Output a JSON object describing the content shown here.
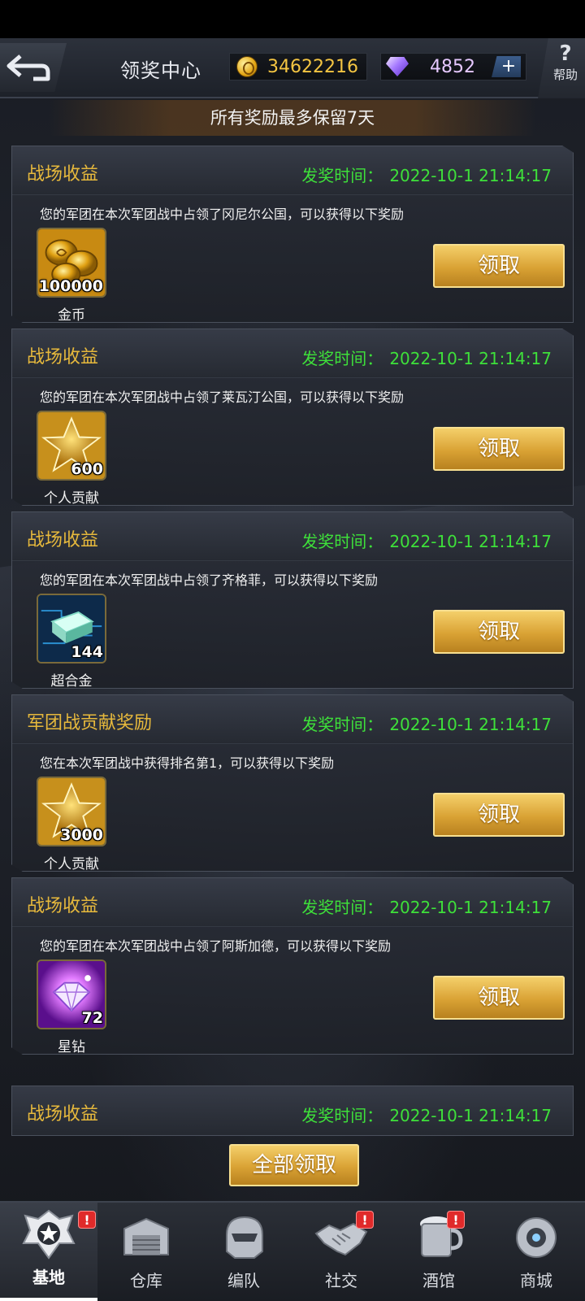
{
  "header": {
    "title": "领奖中心",
    "coins": "34622216",
    "gems": "4852",
    "plus_label": "+",
    "help_icon_glyph": "?",
    "help_label": "帮助"
  },
  "notice": "所有奖励最多保留7天",
  "time_label": "发奖时间：",
  "claim_label": "领取",
  "rewards": [
    {
      "title": "战场收益",
      "time": "2022-10-1 21:14:17",
      "desc": "您的军团在本次军团战中占领了冈尼尔公国，可以获得以下奖励",
      "item_name": "金币",
      "item_count": "100000",
      "icon": "gold-coins-icon"
    },
    {
      "title": "战场收益",
      "time": "2022-10-1 21:14:17",
      "desc": "您的军团在本次军团战中占领了莱瓦汀公国，可以获得以下奖励",
      "item_name": "个人贡献",
      "item_count": "600",
      "icon": "star-icon"
    },
    {
      "title": "战场收益",
      "time": "2022-10-1 21:14:17",
      "desc": "您的军团在本次军团战中占领了齐格菲，可以获得以下奖励",
      "item_name": "超合金",
      "item_count": "144",
      "icon": "alloy-ingot-icon"
    },
    {
      "title": "军团战贡献奖励",
      "time": "2022-10-1 21:14:17",
      "desc": "您在本次军团战中获得排名第1，可以获得以下奖励",
      "item_name": "个人贡献",
      "item_count": "3000",
      "icon": "star-icon"
    },
    {
      "title": "战场收益",
      "time": "2022-10-1 21:14:17",
      "desc": "您的军团在本次军团战中占领了阿斯加德，可以获得以下奖励",
      "item_name": "星钻",
      "item_count": "72",
      "icon": "star-diamond-icon"
    },
    {
      "title": "战场收益",
      "time": "2022-10-1 21:14:17"
    }
  ],
  "claim_all_label": "全部领取",
  "nav": {
    "badge": "!",
    "items": [
      {
        "label": "基地",
        "icon": "base-emblem-icon"
      },
      {
        "label": "仓库",
        "icon": "warehouse-icon"
      },
      {
        "label": "编队",
        "icon": "formation-icon"
      },
      {
        "label": "社交",
        "icon": "handshake-icon"
      },
      {
        "label": "酒馆",
        "icon": "tavern-mug-icon"
      },
      {
        "label": "商城",
        "icon": "shop-icon"
      }
    ]
  },
  "colors": {
    "title_gold": "#e7b93c",
    "time_green": "#3ee03a",
    "button_gold": "#d9a234",
    "badge_red": "#e02a2a"
  }
}
